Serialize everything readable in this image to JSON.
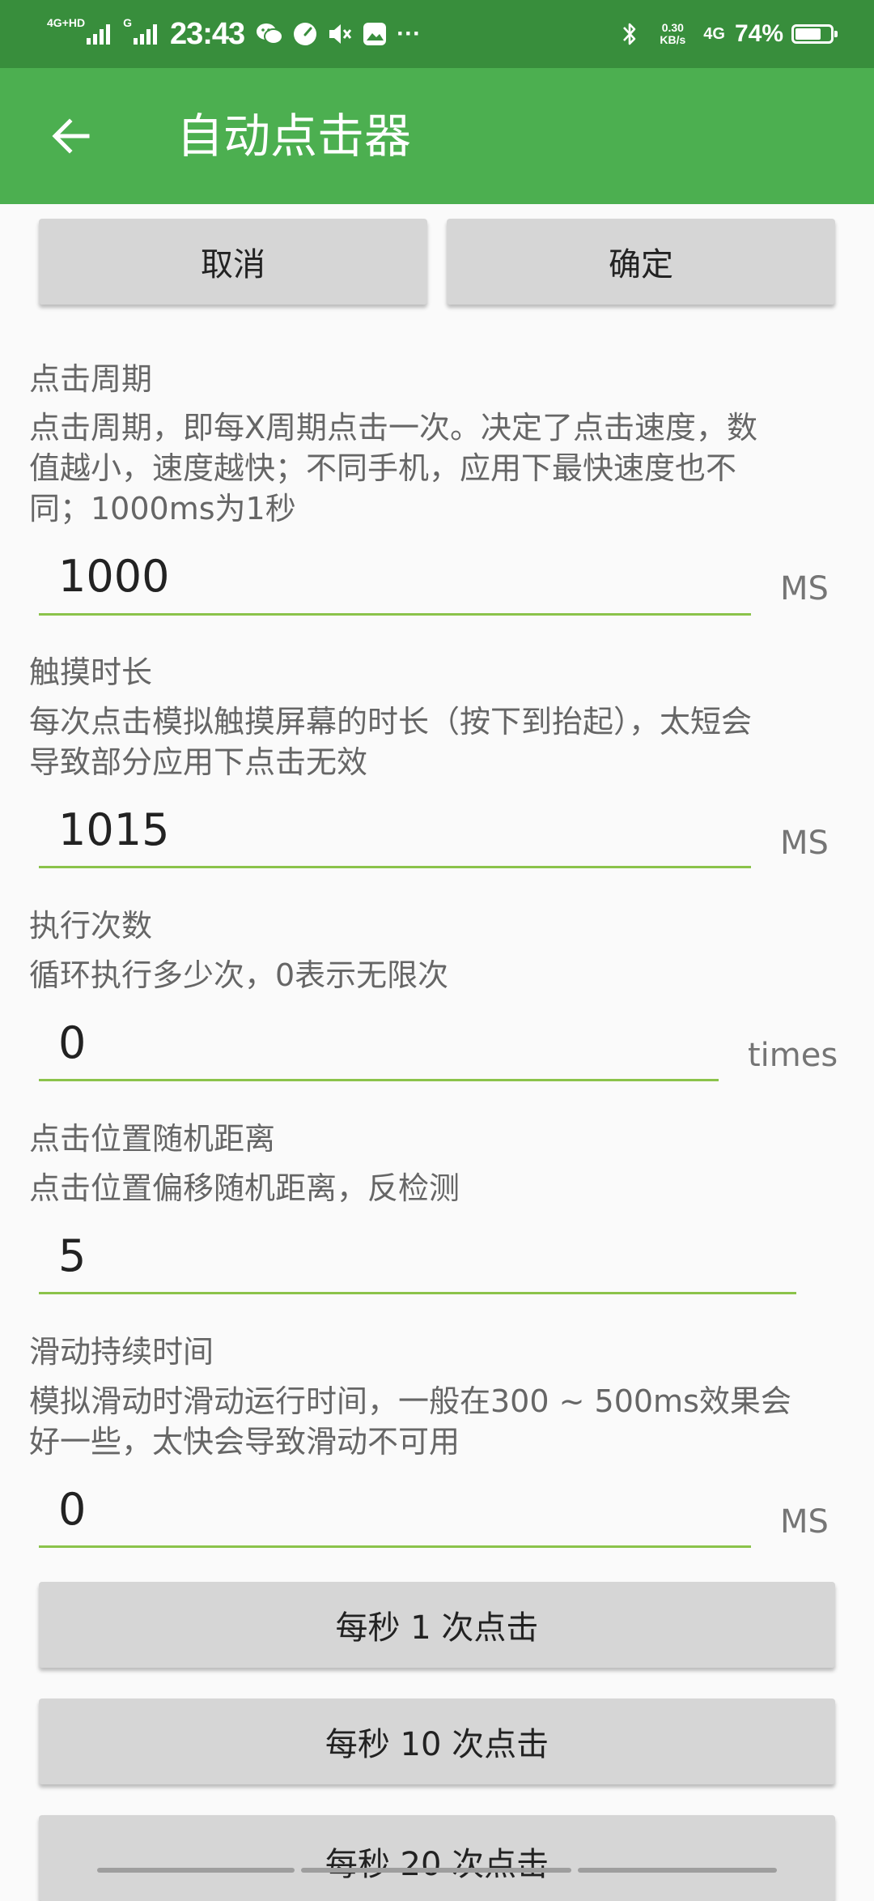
{
  "status_bar": {
    "network_tag": "4G+HD",
    "network_tag_2": "G",
    "time": "23:43",
    "speed_value": "0.30",
    "speed_unit": "KB/s",
    "net_type": "4G",
    "battery_pct": "74%",
    "battery_level": 0.74,
    "more": "···"
  },
  "app_bar": {
    "title": "自动点击器",
    "color": "#4caf50"
  },
  "actions": {
    "cancel_label": "取消",
    "confirm_label": "确定"
  },
  "settings": [
    {
      "label": "点击周期",
      "desc_lines": [
        "点击周期，即每X周期点击一次。决定了点击速度，数",
        "值越小，速度越快；不同手机，应用下最快速度也不",
        "同；1000ms为1秒"
      ],
      "value": "1000",
      "unit": "MS"
    },
    {
      "label": "触摸时长",
      "desc_lines": [
        "每次点击模拟触摸屏幕的时长（按下到抬起），太短会",
        "导致部分应用下点击无效"
      ],
      "value": "1015",
      "unit": "MS"
    },
    {
      "label": "执行次数",
      "desc_lines": [
        "循环执行多少次，0表示无限次"
      ],
      "value": "0",
      "unit": "times"
    },
    {
      "label": "点击位置随机距离",
      "desc_lines": [
        "点击位置偏移随机距离，反检测"
      ],
      "value": "5",
      "unit": ""
    },
    {
      "label": "滑动持续时间",
      "desc_lines": [
        "模拟滑动时滑动运行时间，一般在300 ~ 500ms效果会",
        "好一些，太快会导致滑动不可用"
      ],
      "value": "0",
      "unit": "MS"
    }
  ],
  "presets": [
    "每秒 1 次点击",
    "每秒 10 次点击",
    "每秒 20 次点击"
  ]
}
